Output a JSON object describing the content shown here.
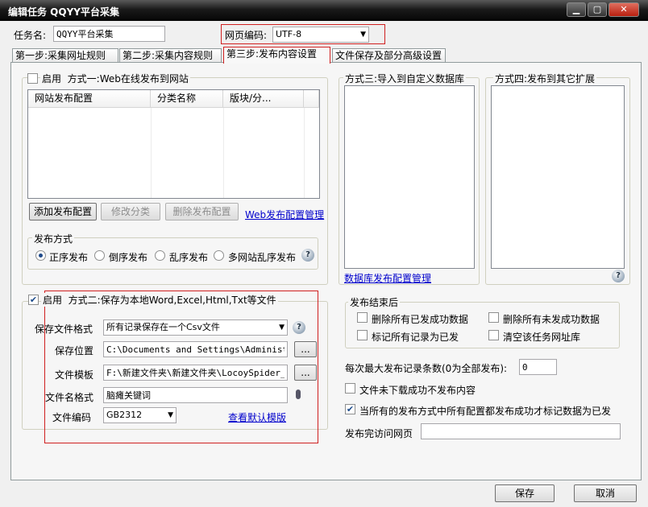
{
  "window": {
    "title": "编辑任务 QQYY平台采集"
  },
  "task_name": {
    "label": "任务名:",
    "value": "QQYY平台采集"
  },
  "encoding": {
    "label": "网页编码:",
    "value": "UTF-8"
  },
  "tabs": [
    {
      "label": "第一步:采集网址规则"
    },
    {
      "label": "第二步:采集内容规则"
    },
    {
      "label": "第三步:发布内容设置"
    },
    {
      "label": "文件保存及部分高级设置"
    }
  ],
  "method1": {
    "enable_label": "启用",
    "title": "方式一:Web在线发布到网站",
    "enabled": false,
    "columns": [
      "网站发布配置",
      "分类名称",
      "版块/分..."
    ],
    "add_button": "添加发布配置",
    "edit_button": "修改分类",
    "delete_button": "删除发布配置",
    "manage_link": "Web发布配置管理",
    "publish_mode": {
      "legend": "发布方式",
      "options": [
        "正序发布",
        "倒序发布",
        "乱序发布",
        "多网站乱序发布"
      ],
      "selected": "正序发布"
    }
  },
  "method2": {
    "enable_label": "启用",
    "title": "方式二:保存为本地Word,Excel,Html,Txt等文件",
    "enabled": true,
    "format_label": "保存文件格式",
    "format_value": "所有记录保存在一个Csv文件",
    "location_label": "保存位置",
    "location_value": "C:\\Documents and Settings\\Administrato",
    "template_label": "文件模板",
    "template_value": "F:\\新建文件夹\\新建文件夹\\LocoySpider_",
    "filename_label": "文件名格式",
    "filename_value": "脑瘫关键词",
    "file_encoding_label": "文件编码",
    "file_encoding_value": "GB2312",
    "view_template_link": "查看默认模版",
    "browse_label": "..."
  },
  "method3": {
    "title": "方式三:导入到自定义数据库",
    "manage_link": "数据库发布配置管理"
  },
  "method4": {
    "title": "方式四:发布到其它扩展"
  },
  "after_publish": {
    "legend": "发布结束后",
    "options": [
      {
        "label": "删除所有已发成功数据",
        "checked": false
      },
      {
        "label": "删除所有未发成功数据",
        "checked": false
      },
      {
        "label": "标记所有记录为已发",
        "checked": false
      },
      {
        "label": "清空该任务网址库",
        "checked": false
      }
    ]
  },
  "max_records": {
    "label": "每次最大发布记录条数(0为全部发布):",
    "value": "0"
  },
  "skip_unsuccessful": {
    "label": "文件未下载成功不发布内容",
    "checked": false
  },
  "mark_published": {
    "label": "当所有的发布方式中所有配置都发布成功才标记数据为已发",
    "checked": true
  },
  "visit_url": {
    "label": "发布完访问网页",
    "value": ""
  },
  "footer": {
    "save_label": "保存",
    "cancel_label": "取消"
  },
  "colors": {
    "highlight_border": "#d02020",
    "link": "#0000cc",
    "titlebar": "#1a1a1a"
  }
}
